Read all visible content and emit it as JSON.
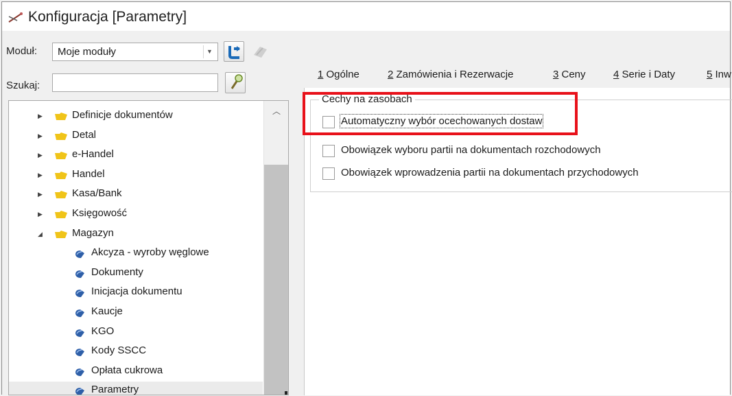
{
  "window": {
    "title": "Konfiguracja [Parametry]",
    "icon": "tools-icon"
  },
  "module": {
    "label": "Moduł:",
    "value": "Moje moduły"
  },
  "search": {
    "label": "Szukaj:",
    "placeholder": ""
  },
  "toolbar": {
    "refresh_icon": "refresh-icon",
    "pin_icon": "pin-icon",
    "search_icon": "search-icon"
  },
  "tree": {
    "items": [
      {
        "label": "Definicje dokumentów",
        "type": "folder",
        "expanded": false
      },
      {
        "label": "Detal",
        "type": "folder",
        "expanded": false
      },
      {
        "label": "e-Handel",
        "type": "folder",
        "expanded": false
      },
      {
        "label": "Handel",
        "type": "folder",
        "expanded": false
      },
      {
        "label": "Kasa/Bank",
        "type": "folder",
        "expanded": false
      },
      {
        "label": "Księgowość",
        "type": "folder",
        "expanded": false
      },
      {
        "label": "Magazyn",
        "type": "folder",
        "expanded": true
      },
      {
        "label": "Akcyza - wyroby węglowe",
        "type": "leaf"
      },
      {
        "label": "Dokumenty",
        "type": "leaf"
      },
      {
        "label": "Inicjacja dokumentu",
        "type": "leaf"
      },
      {
        "label": "Kaucje",
        "type": "leaf"
      },
      {
        "label": "KGO",
        "type": "leaf"
      },
      {
        "label": "Kody SSCC",
        "type": "leaf"
      },
      {
        "label": "Opłata cukrowa",
        "type": "leaf"
      },
      {
        "label": "Parametry",
        "type": "leaf",
        "selected": true
      }
    ]
  },
  "tabs": [
    {
      "key": "1",
      "label": " Ogólne"
    },
    {
      "key": "2",
      "label": " Zamówienia i Rezerwacje"
    },
    {
      "key": "3",
      "label": " Ceny"
    },
    {
      "key": "4",
      "label": " Serie i Daty"
    },
    {
      "key": "5",
      "label": " Inw"
    }
  ],
  "group": {
    "title": "Cechy na zasobach",
    "options": [
      {
        "label": "Automatyczny wybór ocechowanych dostaw",
        "checked": false
      },
      {
        "label": "Obowiązek wyboru partii na dokumentach rozchodowych",
        "checked": false
      },
      {
        "label": "Obowiązek wprowadzenia partii na dokumentach przychodowych",
        "checked": false
      }
    ]
  },
  "colors": {
    "highlight": "#e8111a",
    "folder": "#f0c419",
    "leaf": "#2e5fa8",
    "refresh": "#1a6ab8"
  }
}
